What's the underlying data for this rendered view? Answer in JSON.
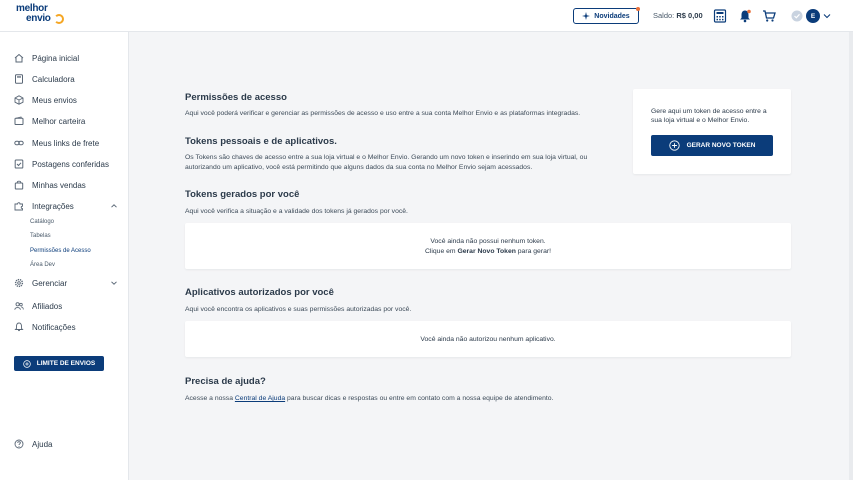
{
  "header": {
    "logo_line1": "melhor",
    "logo_line2": "envio",
    "novidades_label": "Novidades",
    "saldo_label": "Saldo:",
    "saldo_value": "R$ 0,00",
    "avatar_initial": "E"
  },
  "sidebar": {
    "items": [
      {
        "label": "Página inicial"
      },
      {
        "label": "Calculadora"
      },
      {
        "label": "Meus envios"
      },
      {
        "label": "Melhor carteira"
      },
      {
        "label": "Meus links de frete"
      },
      {
        "label": "Postagens conferidas"
      },
      {
        "label": "Minhas vendas"
      },
      {
        "label": "Integrações"
      },
      {
        "label": "Gerenciar"
      },
      {
        "label": "Afiliados"
      },
      {
        "label": "Notificações"
      },
      {
        "label": "Ajuda"
      }
    ],
    "subitems": [
      {
        "label": "Catálogo"
      },
      {
        "label": "Tabelas"
      },
      {
        "label": "Permissões de Acesso"
      },
      {
        "label": "Área Dev"
      }
    ],
    "limite_label": "LIMITE DE ENVIOS"
  },
  "main": {
    "permissoes": {
      "title": "Permissões de acesso",
      "text": "Aqui você poderá verificar e gerenciar as permissões de acesso e uso entre a sua conta Melhor Envio e as plataformas integradas."
    },
    "tokens": {
      "title": "Tokens pessoais e de aplicativos.",
      "text": "Os Tokens são chaves de acesso entre a sua loja virtual e o Melhor Envio. Gerando um novo token e inserindo em sua loja virtual, ou autorizando um aplicativo, você está permitindo que alguns dados da sua conta no Melhor Envio sejam acessados."
    },
    "token_card": {
      "text": "Gere aqui um token de acesso entre a sua loja virtual e o Melhor Envio.",
      "button_label": "GERAR NOVO TOKEN"
    },
    "gerados": {
      "title": "Tokens gerados por você",
      "text": "Aqui você verifica a situação e a validade dos tokens já gerados por você.",
      "empty_line1": "Você ainda não possui nenhum token.",
      "empty_line2_prefix": "Clique em ",
      "empty_line2_bold": "Gerar Novo Token",
      "empty_line2_suffix": " para gerar!"
    },
    "aplicativos": {
      "title": "Aplicativos autorizados por você",
      "text": "Aqui você encontra os aplicativos e suas permissões autorizadas por você.",
      "empty": "Você ainda não autorizou nenhum aplicativo."
    },
    "ajuda": {
      "title": "Precisa de ajuda?",
      "prefix": "Acesse a nossa ",
      "link": "Central de Ajuda",
      "suffix": " para buscar dicas e respostas ou entre em contato com a nossa equipe de atendimento."
    }
  },
  "colors": {
    "brand": "#0b3c7a",
    "accent": "#f5a623",
    "background": "#f4f5f7"
  }
}
